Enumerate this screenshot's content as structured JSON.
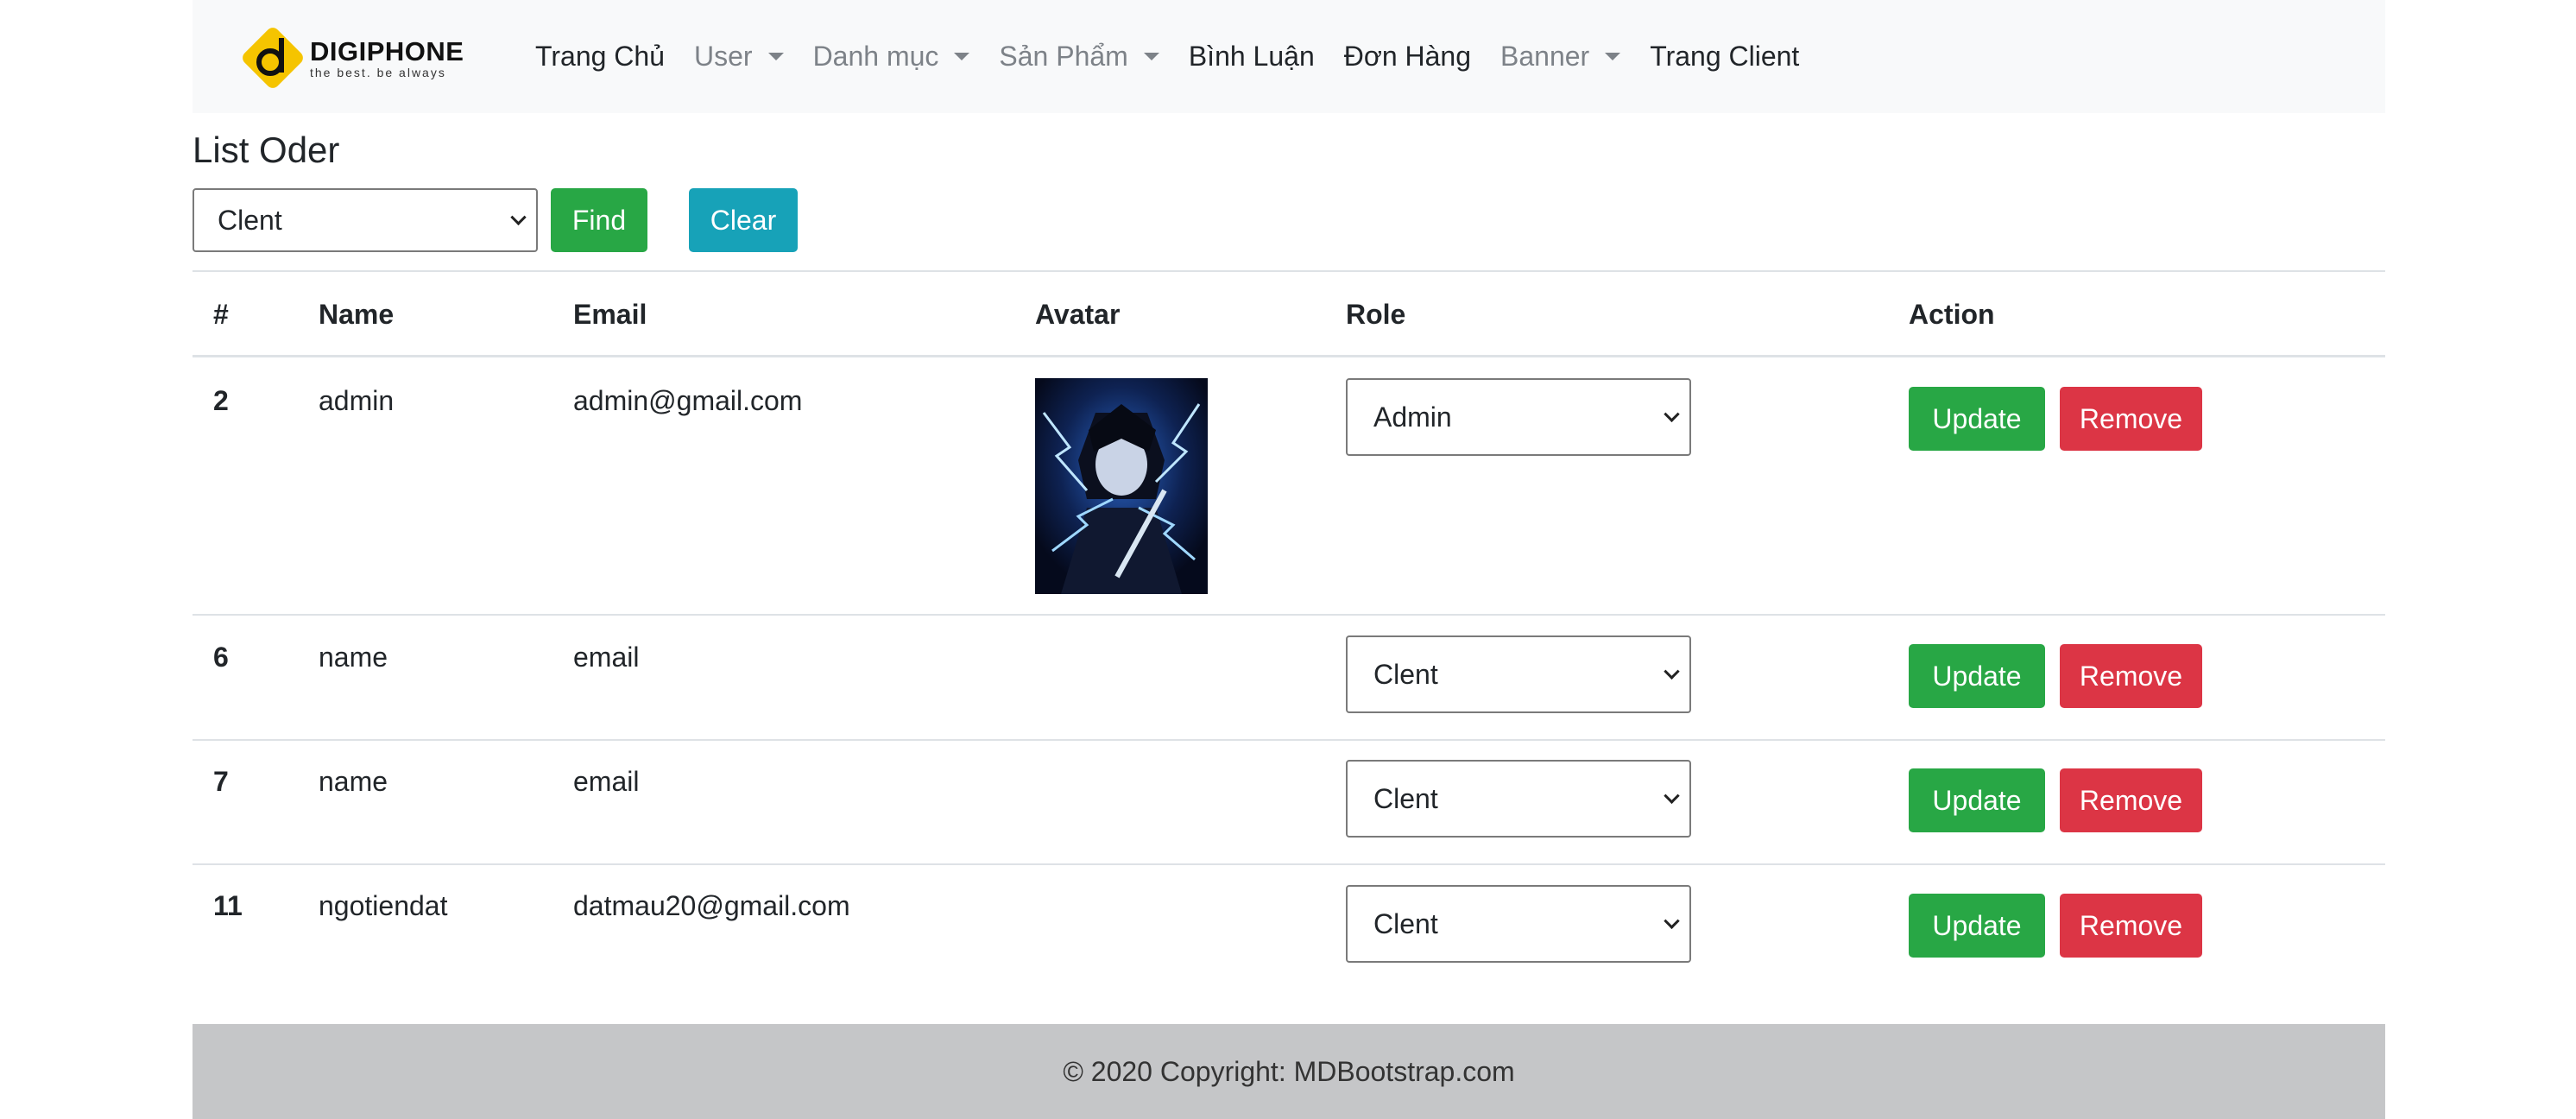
{
  "brand": {
    "name": "DIGIPHONE",
    "tagline": "the best. be always",
    "logo_color": "#f5c400"
  },
  "nav": {
    "items": [
      {
        "label": "Trang Chủ",
        "dropdown": false,
        "muted": false
      },
      {
        "label": "User",
        "dropdown": true,
        "muted": true
      },
      {
        "label": "Danh mục",
        "dropdown": true,
        "muted": true
      },
      {
        "label": "Sản Phẩm",
        "dropdown": true,
        "muted": true
      },
      {
        "label": "Bình Luận",
        "dropdown": false,
        "muted": false
      },
      {
        "label": "Đơn Hàng",
        "dropdown": false,
        "muted": false
      },
      {
        "label": "Banner",
        "dropdown": true,
        "muted": true
      },
      {
        "label": "Trang Client",
        "dropdown": false,
        "muted": false
      }
    ]
  },
  "page": {
    "title": "List Oder"
  },
  "filter": {
    "selected": "Clent",
    "find_label": "Find",
    "clear_label": "Clear"
  },
  "table": {
    "headers": {
      "id": "#",
      "name": "Name",
      "email": "Email",
      "avatar": "Avatar",
      "role": "Role",
      "action": "Action"
    },
    "rows": [
      {
        "id": "2",
        "name": "admin",
        "email": "admin@gmail.com",
        "has_avatar": true,
        "role": "Admin",
        "update_label": "Update",
        "remove_label": "Remove"
      },
      {
        "id": "6",
        "name": "name",
        "email": "email",
        "has_avatar": false,
        "role": "Clent",
        "update_label": "Update",
        "remove_label": "Remove"
      },
      {
        "id": "7",
        "name": "name",
        "email": "email",
        "has_avatar": false,
        "role": "Clent",
        "update_label": "Update",
        "remove_label": "Remove"
      },
      {
        "id": "11",
        "name": "ngotiendat",
        "email": "datmau20@gmail.com",
        "has_avatar": false,
        "role": "Clent",
        "update_label": "Update",
        "remove_label": "Remove"
      }
    ]
  },
  "footer": {
    "text": "© 2020 Copyright: MDBootstrap.com"
  },
  "colors": {
    "success": "#28a745",
    "info": "#17a2b8",
    "danger": "#dc3545",
    "navbar_bg": "#f8f9fa",
    "footer_bg": "#c5c6c8"
  }
}
